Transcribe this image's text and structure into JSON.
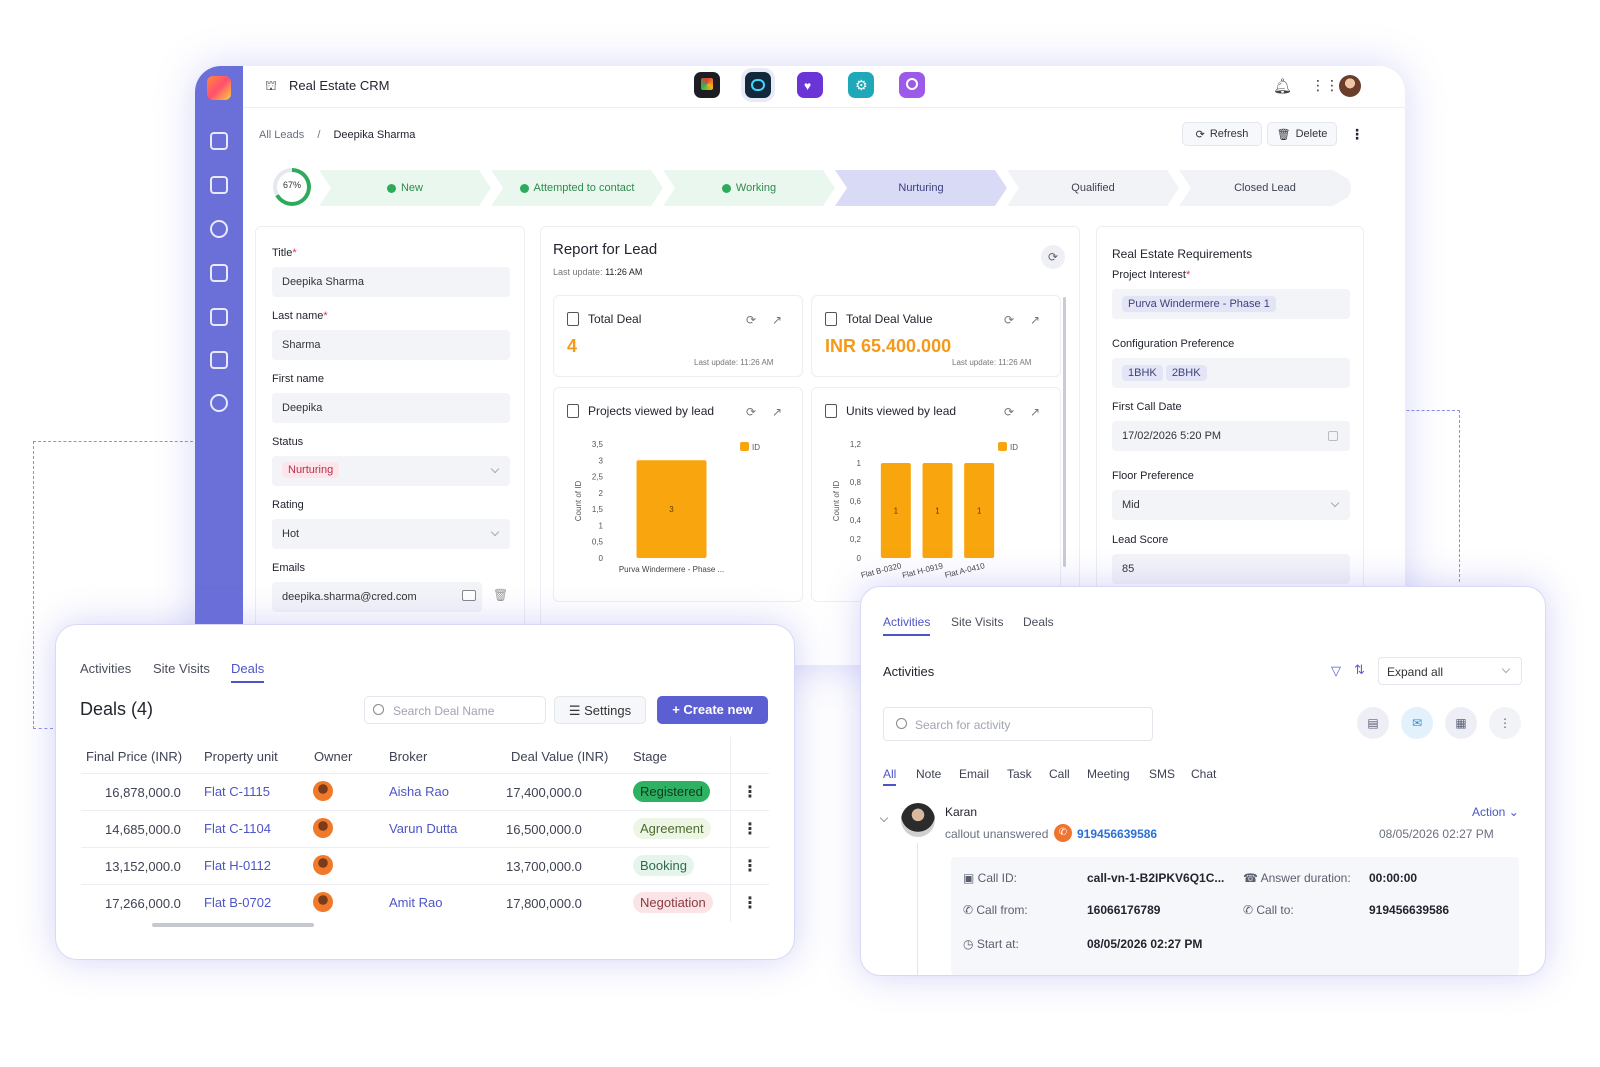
{
  "app": {
    "title": "Real Estate CRM"
  },
  "breadcrumb": {
    "root": "All Leads",
    "separator": "/",
    "current": "Deepika Sharma"
  },
  "header_actions": {
    "refresh": "Refresh",
    "delete": "Delete"
  },
  "progress": {
    "percent_label": "67%",
    "value": 0.67
  },
  "stages": [
    {
      "label": "New",
      "state": "done"
    },
    {
      "label": "Attempted to contact",
      "state": "done"
    },
    {
      "label": "Working",
      "state": "done"
    },
    {
      "label": "Nurturing",
      "state": "current"
    },
    {
      "label": "Qualified",
      "state": "todo"
    },
    {
      "label": "Closed Lead",
      "state": "todo"
    }
  ],
  "form": {
    "title_label": "Title",
    "title_value": "Deepika Sharma",
    "last_name_label": "Last name",
    "last_name_value": "Sharma",
    "first_name_label": "First name",
    "first_name_value": "Deepika",
    "status_label": "Status",
    "status_value": "Nurturing",
    "rating_label": "Rating",
    "rating_value": "Hot",
    "emails_label": "Emails",
    "email_value": "deepika.sharma@cred.com",
    "required_mark": "*"
  },
  "report": {
    "title": "Report for Lead",
    "last_update_label": "Last update:",
    "last_update_time": "11:26 AM",
    "total_deal": {
      "title": "Total Deal",
      "value": "4",
      "updated": "Last update: 11:26 AM"
    },
    "total_deal_value": {
      "title": "Total Deal Value",
      "value": "INR 65.400.000",
      "updated": "Last update: 11:26 AM"
    },
    "projects_chart_title": "Projects viewed by lead",
    "units_chart_title": "Units viewed by lead"
  },
  "chart_data": [
    {
      "type": "bar",
      "title": "Projects viewed by lead",
      "ylabel": "Count of ID",
      "legend": [
        "ID"
      ],
      "legend_position": "top-right",
      "categories": [
        "Purva Windermere - Phase ..."
      ],
      "values": [
        3
      ],
      "ylim": [
        0,
        3.5
      ],
      "yticks": [
        "0",
        "0,5",
        "1",
        "1,5",
        "2",
        "2,5",
        "3",
        "3,5"
      ],
      "color": "#f9a50d"
    },
    {
      "type": "bar",
      "title": "Units viewed by lead",
      "ylabel": "Count of ID",
      "legend": [
        "ID"
      ],
      "legend_position": "top-right",
      "categories": [
        "Flat B-0320",
        "Flat H-0919",
        "Flat A-0410"
      ],
      "values": [
        1,
        1,
        1
      ],
      "ylim": [
        0,
        1.2
      ],
      "yticks": [
        "0",
        "0,2",
        "0,4",
        "0,6",
        "0,8",
        "1",
        "1,2"
      ],
      "color": "#f9a50d"
    }
  ],
  "requirements": {
    "title": "Real Estate Requirements",
    "project_interest_label": "Project Interest",
    "project_interest_value": "Purva Windermere - Phase 1",
    "config_label": "Configuration Preference",
    "config_values": [
      "1BHK",
      "2BHK"
    ],
    "first_call_label": "First Call Date",
    "first_call_value": "17/02/2026 5:20 PM",
    "floor_label": "Floor Preference",
    "floor_value": "Mid",
    "lead_score_label": "Lead Score",
    "lead_score_value": "85"
  },
  "deals": {
    "tabs": [
      "Activities",
      "Site Visits",
      "Deals"
    ],
    "active_tab": "Deals",
    "title": "Deals (4)",
    "search_placeholder": "Search Deal Name",
    "settings_label": "Settings",
    "create_label": "Create new",
    "columns": [
      "Final Price (INR)",
      "Property unit",
      "Owner",
      "Broker",
      "Deal Value (INR)",
      "Stage"
    ],
    "rows": [
      {
        "final_price": "16,878,000.0",
        "unit": "Flat C-1115",
        "broker": "Aisha Rao",
        "deal_value": "17,400,000.0",
        "stage": "Registered"
      },
      {
        "final_price": "14,685,000.0",
        "unit": "Flat C-1104",
        "broker": "Varun Dutta",
        "deal_value": "16,500,000.0",
        "stage": "Agreement"
      },
      {
        "final_price": "13,152,000.0",
        "unit": "Flat H-0112",
        "broker": "",
        "deal_value": "13,700,000.0",
        "stage": "Booking"
      },
      {
        "final_price": "17,266,000.0",
        "unit": "Flat B-0702",
        "broker": "Amit Rao",
        "deal_value": "17,800,000.0",
        "stage": "Negotiation"
      }
    ]
  },
  "activities": {
    "tabs": [
      "Activities",
      "Site Visits",
      "Deals"
    ],
    "active_tab": "Activities",
    "title": "Activities",
    "expand_label": "Expand all",
    "search_placeholder": "Search for activity",
    "filters": [
      "All",
      "Note",
      "Email",
      "Task",
      "Call",
      "Meeting",
      "SMS",
      "Chat"
    ],
    "active_filter": "All",
    "item": {
      "name": "Karan",
      "status": "callout unanswered",
      "phone": "919456639586",
      "action_label": "Action",
      "datetime": "08/05/2026 02:27 PM",
      "call_id_label": "Call ID:",
      "call_id_value": "call-vn-1-B2IPKV6Q1C...",
      "answer_duration_label": "Answer duration:",
      "answer_duration_value": "00:00:00",
      "call_from_label": "Call from:",
      "call_from_value": "16066176789",
      "call_to_label": "Call to:",
      "call_to_value": "919456639586",
      "start_at_label": "Start at:",
      "start_at_value": "08/05/2026 02:27 PM"
    }
  }
}
